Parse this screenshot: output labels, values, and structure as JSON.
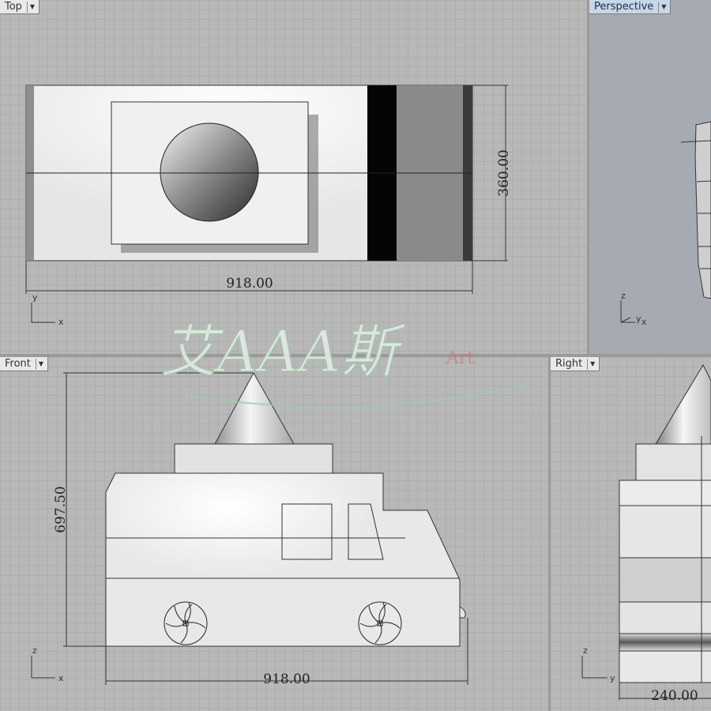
{
  "viewports": {
    "top": {
      "label": "Top",
      "dim_width": "918.00",
      "dim_height": "360.00",
      "axis_y": "y",
      "axis_x": "x"
    },
    "perspective": {
      "label": "Perspective",
      "axis_z": "z",
      "axis_y": "y",
      "axis_x": "x"
    },
    "front": {
      "label": "Front",
      "dim_width": "918.00",
      "dim_height": "697.50",
      "axis_z": "z",
      "axis_x": "x"
    },
    "right": {
      "label": "Right",
      "dim_width": "240.00",
      "axis_z": "z",
      "axis_y": "y"
    }
  },
  "watermark": {
    "text": "艾AAA斯",
    "sub": "Art"
  },
  "icons": {
    "dropdown": "chevron-down-icon"
  },
  "colors": {
    "active_label_bg": "#c6d7ea",
    "grid_bg": "#b8b8b8",
    "perspective_bg": "#a6abb3"
  }
}
